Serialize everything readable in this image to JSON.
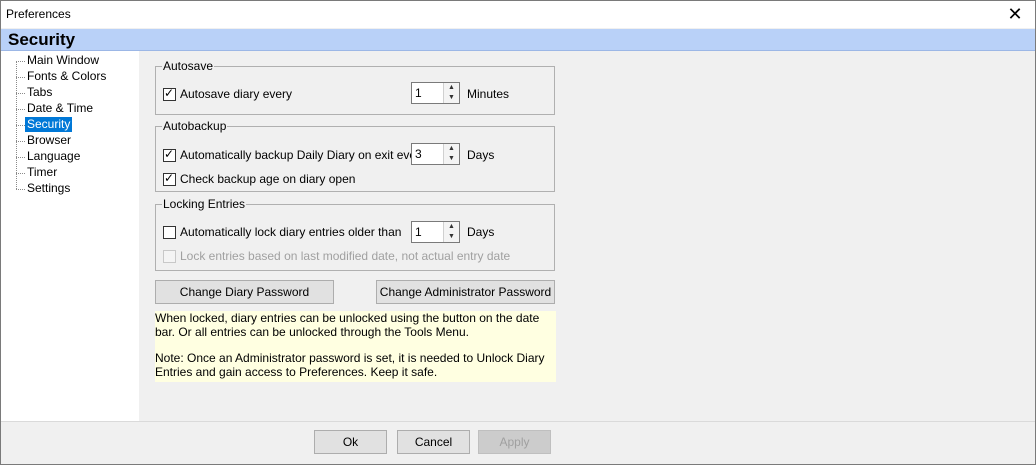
{
  "window": {
    "title": "Preferences",
    "close_icon": "close-icon"
  },
  "header": {
    "title": "Security"
  },
  "tree": {
    "items": [
      {
        "label": "Main Window"
      },
      {
        "label": "Fonts & Colors"
      },
      {
        "label": "Tabs"
      },
      {
        "label": "Date & Time"
      },
      {
        "label": "Security",
        "selected": true
      },
      {
        "label": "Browser"
      },
      {
        "label": "Language"
      },
      {
        "label": "Timer"
      },
      {
        "label": "Settings"
      }
    ]
  },
  "autosave": {
    "label": "Autosave",
    "checkbox_label": "Autosave diary every",
    "checked": true,
    "value": "1",
    "unit": "Minutes"
  },
  "autobackup": {
    "label": "Autobackup",
    "checkbox_label": "Automatically backup Daily Diary on exit every",
    "checked": true,
    "value": "3",
    "unit": "Days",
    "check_age_label": "Check backup age on diary open",
    "check_age_checked": true
  },
  "locking": {
    "label": "Locking Entries",
    "checkbox_label": "Automatically lock diary entries older than",
    "checked": false,
    "value": "1",
    "unit": "Days",
    "modified_label": "Lock entries based on last modified date, not actual entry date",
    "modified_checked": false
  },
  "buttons": {
    "change_diary_password": "Change Diary Password",
    "change_admin_password": "Change Administrator Password",
    "ok": "Ok",
    "cancel": "Cancel",
    "apply": "Apply"
  },
  "note": {
    "paragraph1": "When locked, diary entries can be unlocked using the button on the date bar. Or all entries can be unlocked through the Tools Menu.",
    "paragraph2": "Note: Once an Administrator password is set, it is needed to Unlock Diary Entries and gain access to Preferences. Keep it safe."
  },
  "colors": {
    "header_bg": "#b9d1f8",
    "selected_bg": "#0078d7",
    "note_bg": "#ffffe1"
  }
}
